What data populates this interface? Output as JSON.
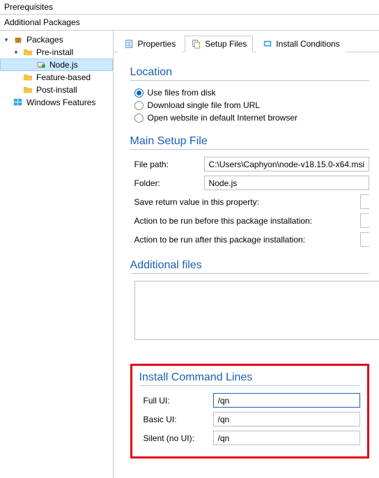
{
  "headers": {
    "h1": "Prerequisites",
    "h2": "Additional Packages"
  },
  "tree": {
    "packages": "Packages",
    "pre_install": "Pre-install",
    "node": "Node.js",
    "feature_based": "Feature-based",
    "post_install": "Post-install",
    "windows_features": "Windows Features"
  },
  "tabs": {
    "properties": "Properties",
    "setup_files": "Setup Files",
    "install_conditions": "Install Conditions"
  },
  "location": {
    "title": "Location",
    "opt_disk": "Use files from disk",
    "opt_url": "Download single file from URL",
    "opt_browser": "Open website in default Internet browser"
  },
  "main_setup": {
    "title": "Main Setup File",
    "file_path_label": "File path:",
    "file_path_value": "C:\\Users\\Caphyon\\node-v18.15.0-x64.msi",
    "folder_label": "Folder:",
    "folder_value": "Node.js",
    "save_return_label": "Save return value in this property:",
    "before_label": "Action to be run before this package installation:",
    "after_label": "Action to be run after this package installation:"
  },
  "additional_files": {
    "title": "Additional files"
  },
  "install_cmd": {
    "title": "Install Command Lines",
    "full_label": "Full UI:",
    "full_value": "/qn",
    "basic_label": "Basic UI:",
    "basic_value": "/qn",
    "silent_label": "Silent (no UI):",
    "silent_value": "/qn"
  }
}
